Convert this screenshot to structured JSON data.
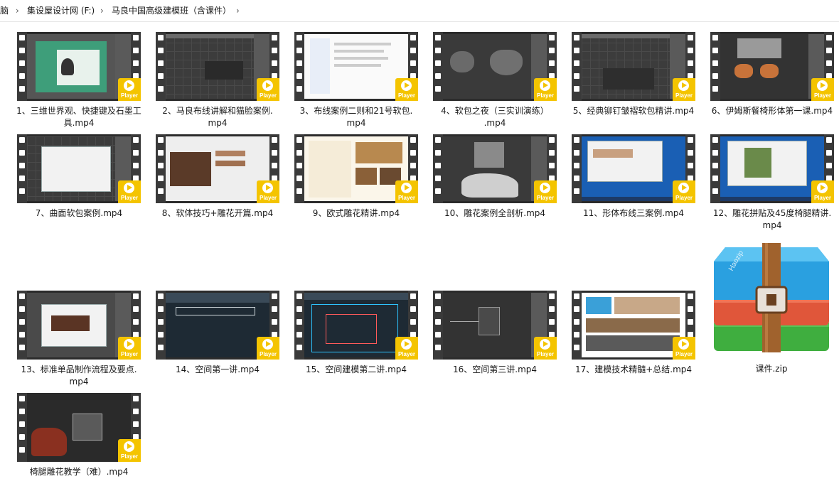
{
  "breadcrumb": {
    "items": [
      "脑",
      "集设屋设计网 (F:)",
      "马良中国高级建模班（含课件）"
    ]
  },
  "player_badge": "Player",
  "files": [
    {
      "name": "1、三维世界观、快捷键及石墨工具.mp4",
      "line1": "1、三维世界观、快捷键及石墨工",
      "line2": "具.mp4"
    },
    {
      "name": "2、马良布线讲解和猫脸案例.mp4",
      "line1": "2、马良布线讲解和猫脸案例.",
      "line2": "mp4"
    },
    {
      "name": "3、布线案例二则和21号软包.mp4",
      "line1": "3、布线案例二则和21号软包.",
      "line2": "mp4"
    },
    {
      "name": "4、软包之夜（三实训演练）.mp4",
      "line1": "4、软包之夜（三实训演练）",
      "line2": ".mp4"
    },
    {
      "name": "5、经典铆钉皱褶软包精讲.mp4",
      "line1": "5、经典铆钉皱褶软包精讲.mp4",
      "line2": ""
    },
    {
      "name": "6、伊姆斯餐椅形体第一课.mp4",
      "line1": "6、伊姆斯餐椅形体第一课.mp4",
      "line2": ""
    },
    {
      "name": "7、曲面软包案例.mp4",
      "line1": "7、曲面软包案例.mp4",
      "line2": ""
    },
    {
      "name": "8、软体技巧+雕花开篇.mp4",
      "line1": "8、软体技巧+雕花开篇.mp4",
      "line2": ""
    },
    {
      "name": "9、欧式雕花精讲.mp4",
      "line1": "9、欧式雕花精讲.mp4",
      "line2": ""
    },
    {
      "name": "10、雕花案例全剖析.mp4",
      "line1": "10、雕花案例全剖析.mp4",
      "line2": ""
    },
    {
      "name": "11、形体布线三案例.mp4",
      "line1": "11、形体布线三案例.mp4",
      "line2": ""
    },
    {
      "name": "12、雕花拼贴及45度椅腿精讲.mp4",
      "line1": "12、雕花拼贴及45度椅腿精讲.",
      "line2": "mp4"
    },
    {
      "name": "13、标准单品制作流程及要点.mp4",
      "line1": "13、标准单品制作流程及要点.",
      "line2": "mp4"
    },
    {
      "name": "14、空间第一讲.mp4",
      "line1": "14、空间第一讲.mp4",
      "line2": ""
    },
    {
      "name": "15、空间建模第二讲.mp4",
      "line1": "15、空间建模第二讲.mp4",
      "line2": ""
    },
    {
      "name": "16、空间第三讲.mp4",
      "line1": "16、空间第三讲.mp4",
      "line2": ""
    },
    {
      "name": "17、建模技术精髓+总结.mp4",
      "line1": "17、建模技术精髓+总结.mp4",
      "line2": ""
    },
    {
      "name": "椅腿雕花教学（难）.mp4",
      "line1": "椅腿雕花教学（难）.mp4",
      "line2": ""
    }
  ],
  "zip_file": {
    "name": "课件.zip",
    "brand": "Haozip"
  },
  "colors": {
    "play_badge": "#f4c400",
    "film_strip": "#3a3a3a",
    "zip_blue": "#2aa0e0",
    "zip_red": "#e0563a",
    "zip_green": "#3fae3f",
    "zip_belt": "#a0622d"
  }
}
